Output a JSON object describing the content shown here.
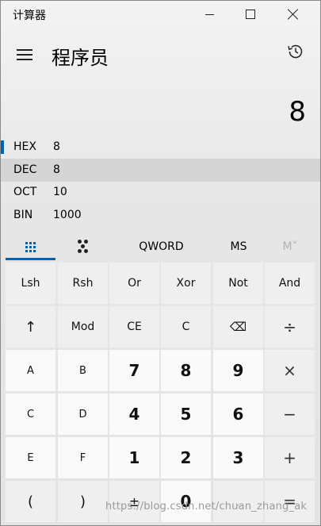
{
  "window": {
    "title": "计算器"
  },
  "header": {
    "mode": "程序员",
    "menu_icon": "hamburger-menu-icon",
    "history_icon": "history-clock-icon"
  },
  "display": {
    "value": "8"
  },
  "radix": [
    {
      "name": "HEX",
      "value": "8",
      "indicated": true
    },
    {
      "name": "DEC",
      "value": "8",
      "active": true
    },
    {
      "name": "OCT",
      "value": "10"
    },
    {
      "name": "BIN",
      "value": "1000"
    }
  ],
  "tabs": [
    {
      "icon": "keypad-grid-icon",
      "selected": true
    },
    {
      "icon": "bit-toggle-icon"
    },
    {
      "label": "QWORD"
    },
    {
      "label": "MS"
    },
    {
      "label": "M˅",
      "disabled": true
    }
  ],
  "keys": [
    [
      "Lsh",
      "Rsh",
      "Or",
      "Xor",
      "Not",
      "And"
    ],
    [
      "↑",
      "Mod",
      "CE",
      "C",
      "⌫",
      "÷"
    ],
    [
      "A",
      "B",
      "7",
      "8",
      "9",
      "×"
    ],
    [
      "C",
      "D",
      "4",
      "5",
      "6",
      "−"
    ],
    [
      "E",
      "F",
      "1",
      "2",
      "3",
      "+"
    ],
    [
      "(",
      ")",
      "±",
      "0",
      ".",
      "="
    ]
  ],
  "watermark": "https://blog.csdn.net/chuan_zhang_ak",
  "colors": {
    "accent": "#0063b1",
    "background": "#e6e6e6"
  }
}
